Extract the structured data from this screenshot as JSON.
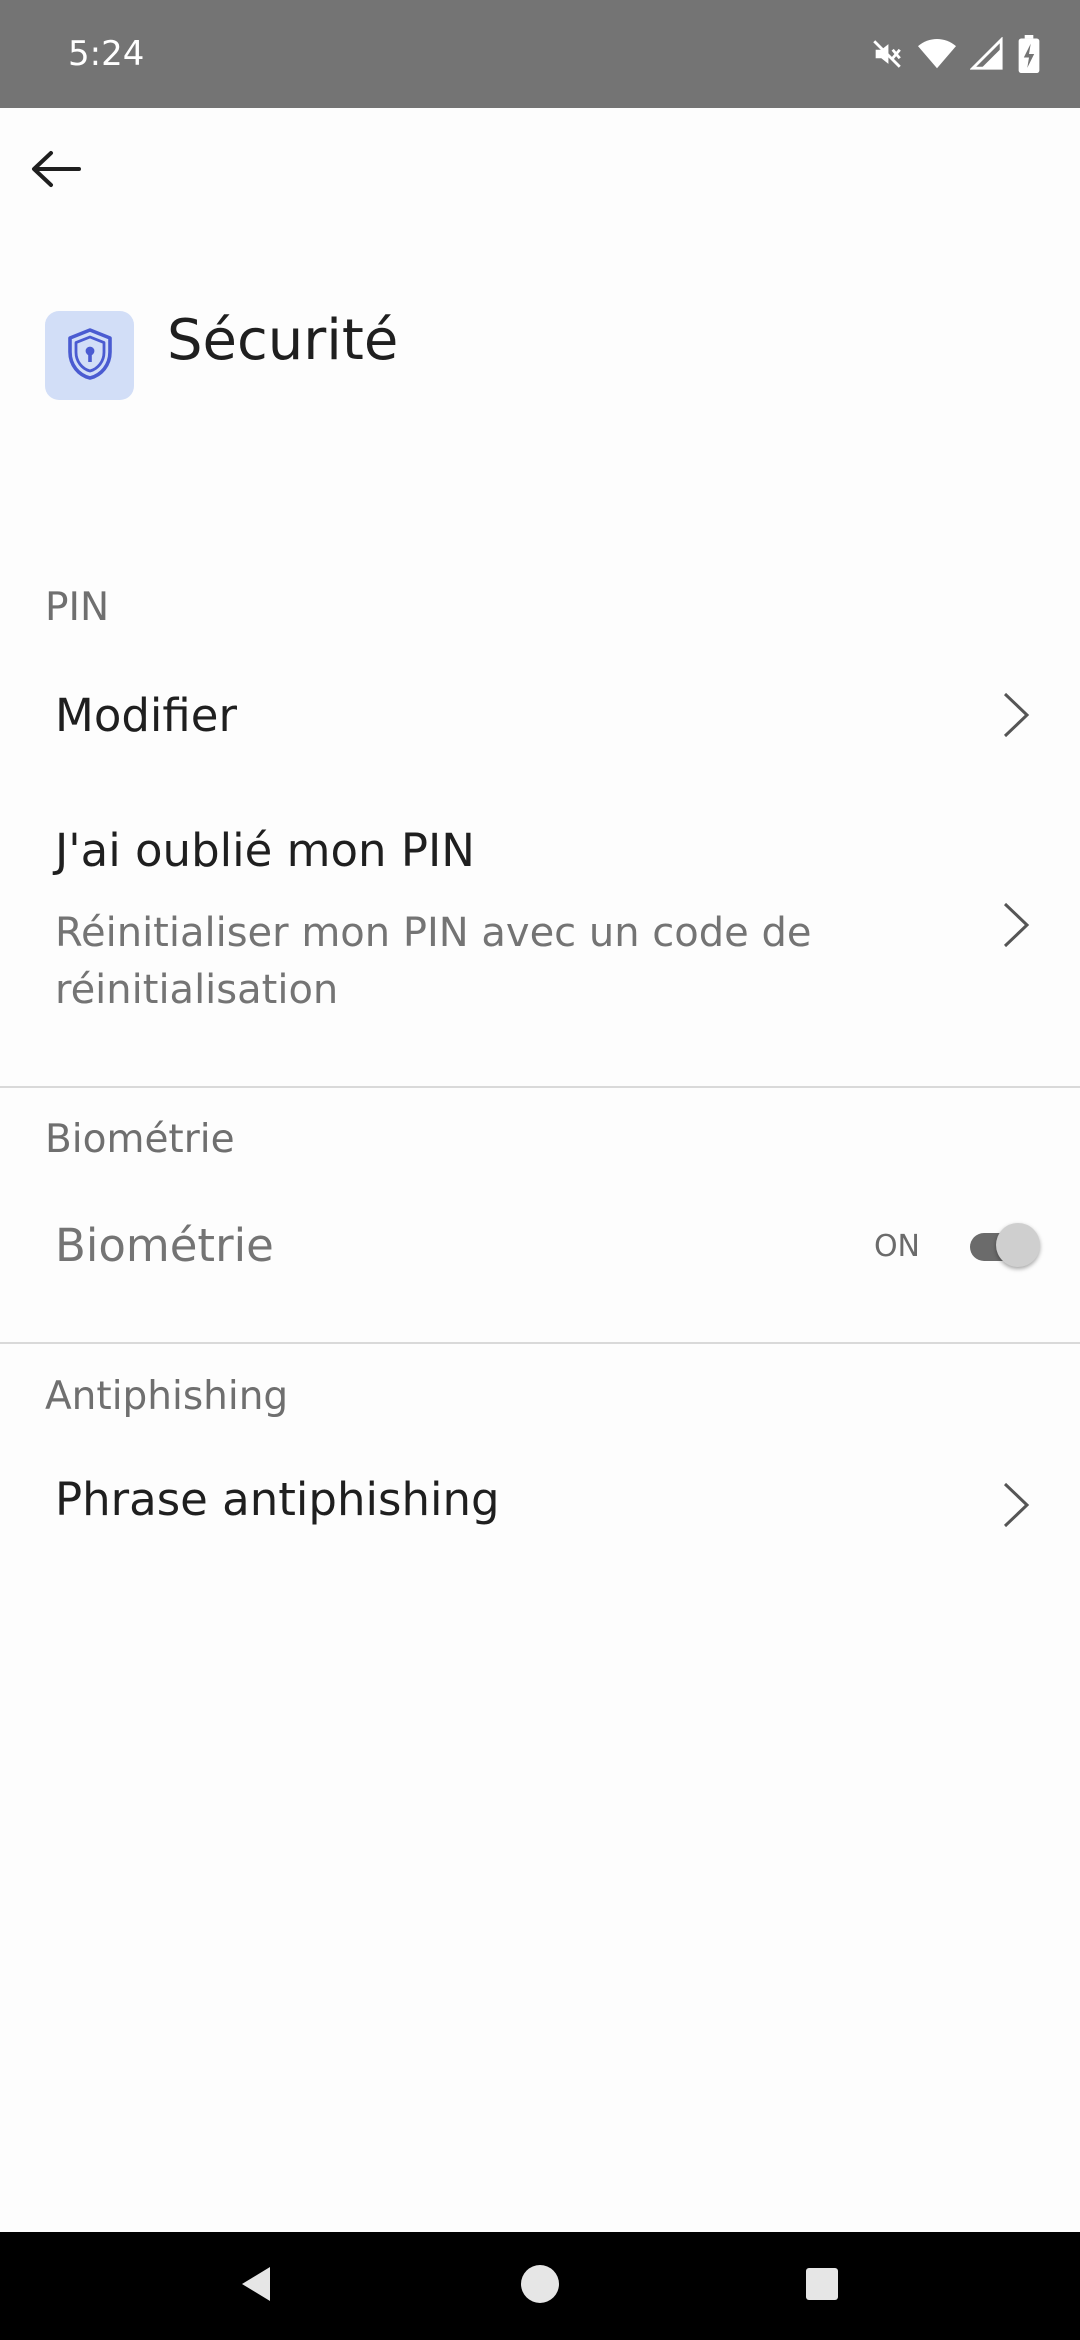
{
  "status_bar": {
    "time": "5:24",
    "icons": [
      "mute-icon",
      "wifi-icon",
      "signal-icon",
      "battery-charging-icon"
    ]
  },
  "top_bar": {
    "back_icon": "arrow-left-icon"
  },
  "header": {
    "icon": "shield-lock-icon",
    "title": "Sécurité",
    "icon_bg_color": "#d2def7",
    "icon_color": "#4a5bd1"
  },
  "sections": {
    "pin": {
      "title": "PIN",
      "items": [
        {
          "label": "Modifier"
        },
        {
          "label": "J'ai oublié mon PIN",
          "subtitle": "Réinitialiser mon PIN avec un code de réinitialisation"
        }
      ]
    },
    "biometrics": {
      "title": "Biométrie",
      "item_label": "Biométrie",
      "toggle_state": "ON",
      "toggle_on": true
    },
    "antiphishing": {
      "title": "Antiphishing",
      "items": [
        {
          "label": "Phrase antiphishing"
        }
      ]
    }
  },
  "nav_bar": {
    "buttons": [
      "nav-back-icon",
      "nav-home-icon",
      "nav-recents-icon"
    ]
  }
}
